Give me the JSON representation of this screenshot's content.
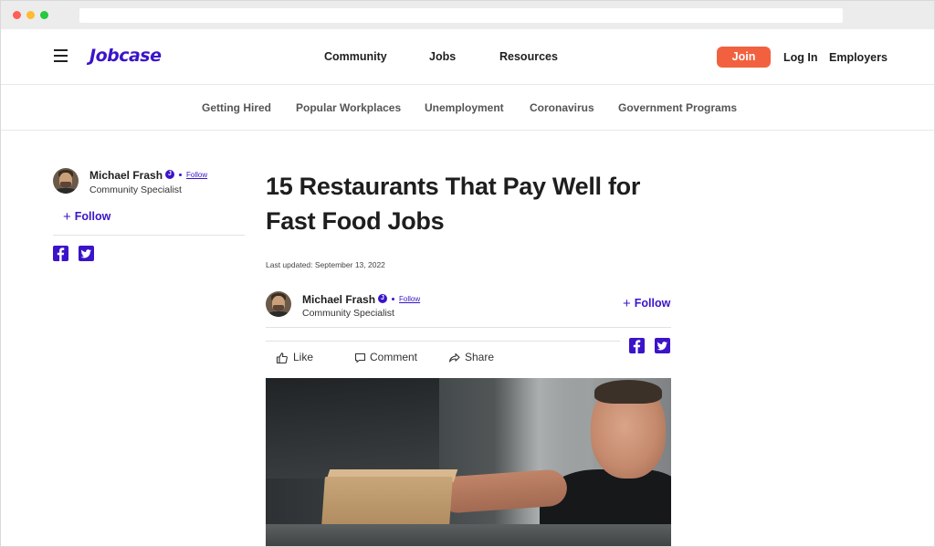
{
  "header": {
    "logo": "Jobcase",
    "nav": [
      "Community",
      "Jobs",
      "Resources"
    ],
    "join_label": "Join",
    "login_label": "Log In",
    "employers_label": "Employers"
  },
  "subnav": [
    "Getting Hired",
    "Popular Workplaces",
    "Unemployment",
    "Coronavirus",
    "Government Programs"
  ],
  "sidebar": {
    "author_name": "Michael Frash",
    "verified_glyph": "J",
    "small_follow": "Follow",
    "author_role": "Community Specialist",
    "follow_label": "Follow",
    "follow_glyph": "+"
  },
  "article": {
    "title": "15 Restaurants That Pay Well for Fast Food Jobs",
    "last_updated": "Last updated: September 13, 2022",
    "author_name": "Michael Frash",
    "verified_glyph": "J",
    "small_follow": "Follow",
    "author_role": "Community Specialist",
    "follow_label": "Follow",
    "follow_glyph": "+",
    "actions": {
      "like": "Like",
      "comment": "Comment",
      "share": "Share"
    }
  },
  "colors": {
    "brand": "#3b14c9",
    "join": "#f2613f"
  },
  "icons": [
    "hamburger-icon",
    "verified-icon",
    "plus-icon",
    "facebook-icon",
    "twitter-icon",
    "like-icon",
    "comment-icon",
    "share-icon"
  ]
}
